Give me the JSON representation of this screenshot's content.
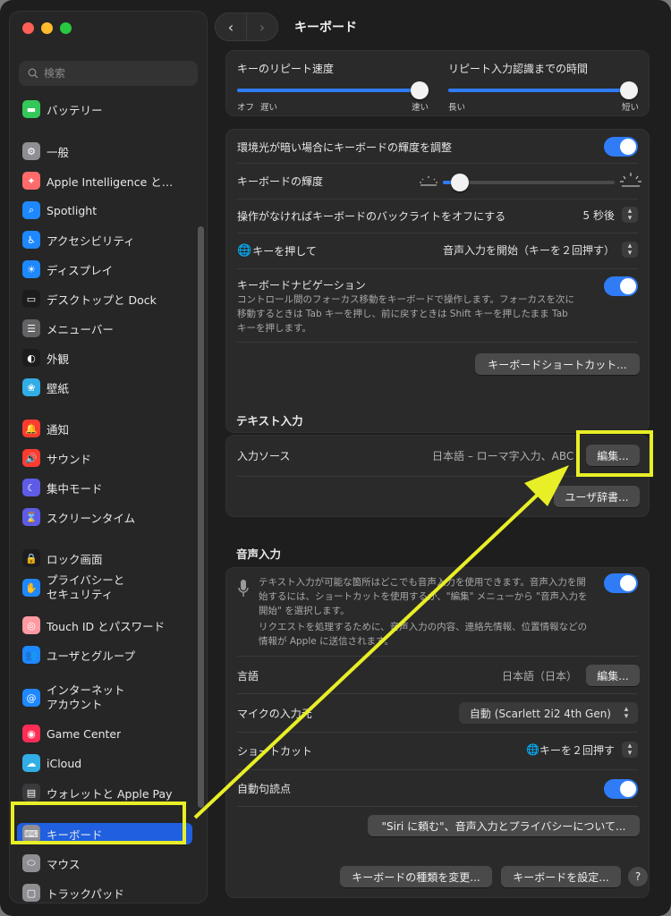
{
  "sidebar": {
    "search_placeholder": "検索",
    "items": [
      {
        "label": "バッテリー",
        "icon": "battery-icon",
        "color": "#34c759"
      },
      {
        "label": "一般",
        "icon": "gear-icon",
        "color": "#8e8e93"
      },
      {
        "label": "Apple Intelligence と…",
        "icon": "apple-intelligence-icon",
        "color": "#ff6b6b"
      },
      {
        "label": "Spotlight",
        "icon": "spotlight-search-icon",
        "color": "#1e88ff"
      },
      {
        "label": "アクセシビリティ",
        "icon": "accessibility-icon",
        "color": "#1e88ff"
      },
      {
        "label": "ディスプレイ",
        "icon": "display-sun-icon",
        "color": "#1e88ff"
      },
      {
        "label": "デスクトップと Dock",
        "icon": "desktop-dock-icon",
        "color": "#1c1c1e"
      },
      {
        "label": "メニューバー",
        "icon": "menubar-icon",
        "color": "#636366"
      },
      {
        "label": "外観",
        "icon": "appearance-icon",
        "color": "#1c1c1e"
      },
      {
        "label": "壁紙",
        "icon": "wallpaper-icon",
        "color": "#32ade6"
      },
      {
        "label": "通知",
        "icon": "notifications-bell-icon",
        "color": "#ff3b30"
      },
      {
        "label": "サウンド",
        "icon": "sound-speaker-icon",
        "color": "#ff3b30"
      },
      {
        "label": "集中モード",
        "icon": "focus-moon-icon",
        "color": "#5e5ce6"
      },
      {
        "label": "スクリーンタイム",
        "icon": "screen-time-hourglass-icon",
        "color": "#5e5ce6"
      },
      {
        "label": "ロック画面",
        "icon": "lock-screen-icon",
        "color": "#1c1c1e"
      },
      {
        "label": "プライバシーと\nセキュリティ",
        "icon": "privacy-hand-icon",
        "color": "#1e88ff"
      },
      {
        "label": "Touch ID とパスワード",
        "icon": "fingerprint-icon",
        "color": "#ff9aa2"
      },
      {
        "label": "ユーザとグループ",
        "icon": "users-icon",
        "color": "#1e88ff"
      },
      {
        "label": "インターネット\nアカウント",
        "icon": "at-sign-icon",
        "color": "#1e88ff"
      },
      {
        "label": "Game Center",
        "icon": "game-center-icon",
        "color": "#ff2d55"
      },
      {
        "label": "iCloud",
        "icon": "icloud-icon",
        "color": "#32ade6"
      },
      {
        "label": "ウォレットと Apple Pay",
        "icon": "wallet-icon",
        "color": "#3a3a3c"
      },
      {
        "label": "キーボード",
        "icon": "keyboard-icon",
        "color": "#8e8e93"
      },
      {
        "label": "マウス",
        "icon": "mouse-icon",
        "color": "#8e8e93"
      },
      {
        "label": "トラックパッド",
        "icon": "trackpad-icon",
        "color": "#8e8e93"
      }
    ]
  },
  "header": {
    "title": "キーボード",
    "back_glyph": "‹",
    "forward_glyph": "›"
  },
  "repeat": {
    "speed_label": "キーのリピート速度",
    "speed_min": "オフ",
    "speed_slow": "遅い",
    "speed_max": "速い",
    "speed_level": 1.0,
    "delay_label": "リピート入力認識までの時間",
    "delay_min": "長い",
    "delay_max": "短い",
    "delay_level": 1.0
  },
  "backlight": {
    "ambient_label": "環境光が暗い場合にキーボードの輝度を調整",
    "ambient_on": true,
    "brightness_label": "キーボードの輝度",
    "brightness_level": 0.05,
    "off_label": "操作がなければキーボードのバックライトをオフにする",
    "off_value": "5 秒後",
    "globe_label": "キーを押して",
    "globe_value": "音声入力を開始（キーを２回押す）",
    "nav_label": "キーボードナビゲーション",
    "nav_desc": "コントロール間のフォーカス移動をキーボードで操作します。フォーカスを次に移動するときは Tab キーを押し、前に戻すときは Shift キーを押したまま Tab キーを押します。",
    "nav_on": true,
    "shortcuts_button": "キーボードショートカット..."
  },
  "text_input": {
    "section": "テキスト入力",
    "sources_label": "入力ソース",
    "sources_value": "日本語 – ローマ字入力、ABC",
    "edit_button": "編集...",
    "dictionary_button": "ユーザ辞書..."
  },
  "dictation": {
    "section": "音声入力",
    "desc1": "テキスト入力が可能な箇所はどこでも音声入力を使用できます。音声入力を開始するには、ショートカットを使用するか、\"編集\" メニューから \"音声入力を開始\" を選択します。",
    "desc2": "リクエストを処理するために、音声入力の内容、連絡先情報、位置情報などの情報が Apple に送信されます。",
    "on": true,
    "language_label": "言語",
    "language_value": "日本語（日本）",
    "language_edit": "編集...",
    "mic_label": "マイクの入力元",
    "mic_value": "自動 (Scarlett 2i2 4th Gen)",
    "shortcut_label": "ショートカット",
    "shortcut_value": "キーを２回押す",
    "punct_label": "自動句読点",
    "punct_on": true,
    "about_button": "\"Siri に頼む\"、音声入力とプライバシーについて..."
  },
  "footer": {
    "change_type": "キーボードの種類を変更...",
    "setup": "キーボードを設定...",
    "help": "?"
  },
  "annotation": {
    "color": "#e8ef26"
  }
}
